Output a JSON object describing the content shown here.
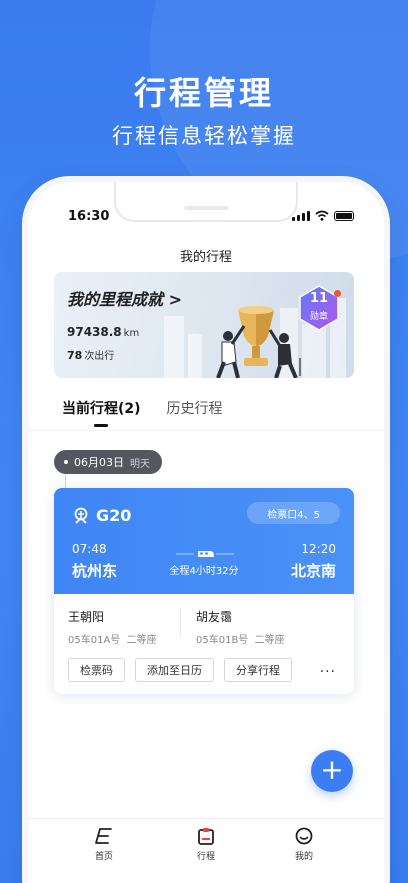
{
  "hero": {
    "title": "行程管理",
    "subtitle": "行程信息轻松掌握"
  },
  "status_bar": {
    "time": "16:30"
  },
  "page": {
    "title": "我的行程"
  },
  "banner": {
    "title": "我的里程成就",
    "arrow": ">",
    "distance": "97438.8",
    "distance_unit": "km",
    "trips": "78",
    "trips_unit": "次出行",
    "badge_count": "11",
    "badge_label": "勋章"
  },
  "tabs": [
    {
      "label": "当前行程(2)",
      "active": true
    },
    {
      "label": "历史行程",
      "active": false
    }
  ],
  "date_group": {
    "date": "06月03日",
    "relative": "明天"
  },
  "trip_card": {
    "train_no": "G20",
    "gate": "检票口4、5",
    "depart_time": "07:48",
    "depart_station": "杭州东",
    "arrive_time": "12:20",
    "arrive_station": "北京南",
    "duration": "全程4小时32分",
    "passengers": [
      {
        "name": "王朝阳",
        "seat": "05车01A号",
        "class": "二等座"
      },
      {
        "name": "胡友霭",
        "seat": "05车01B号",
        "class": "二等座"
      }
    ],
    "actions": {
      "ticket_code": "检票码",
      "add_calendar": "添加至日历",
      "share": "分享行程",
      "more": "···"
    },
    "accent_color": "#3f86f5"
  },
  "fab": {
    "label": "+"
  },
  "tab_bar": {
    "items": [
      {
        "label": "首页",
        "icon": "home-icon"
      },
      {
        "label": "行程",
        "icon": "trip-icon"
      },
      {
        "label": "我的",
        "icon": "profile-icon"
      }
    ]
  }
}
